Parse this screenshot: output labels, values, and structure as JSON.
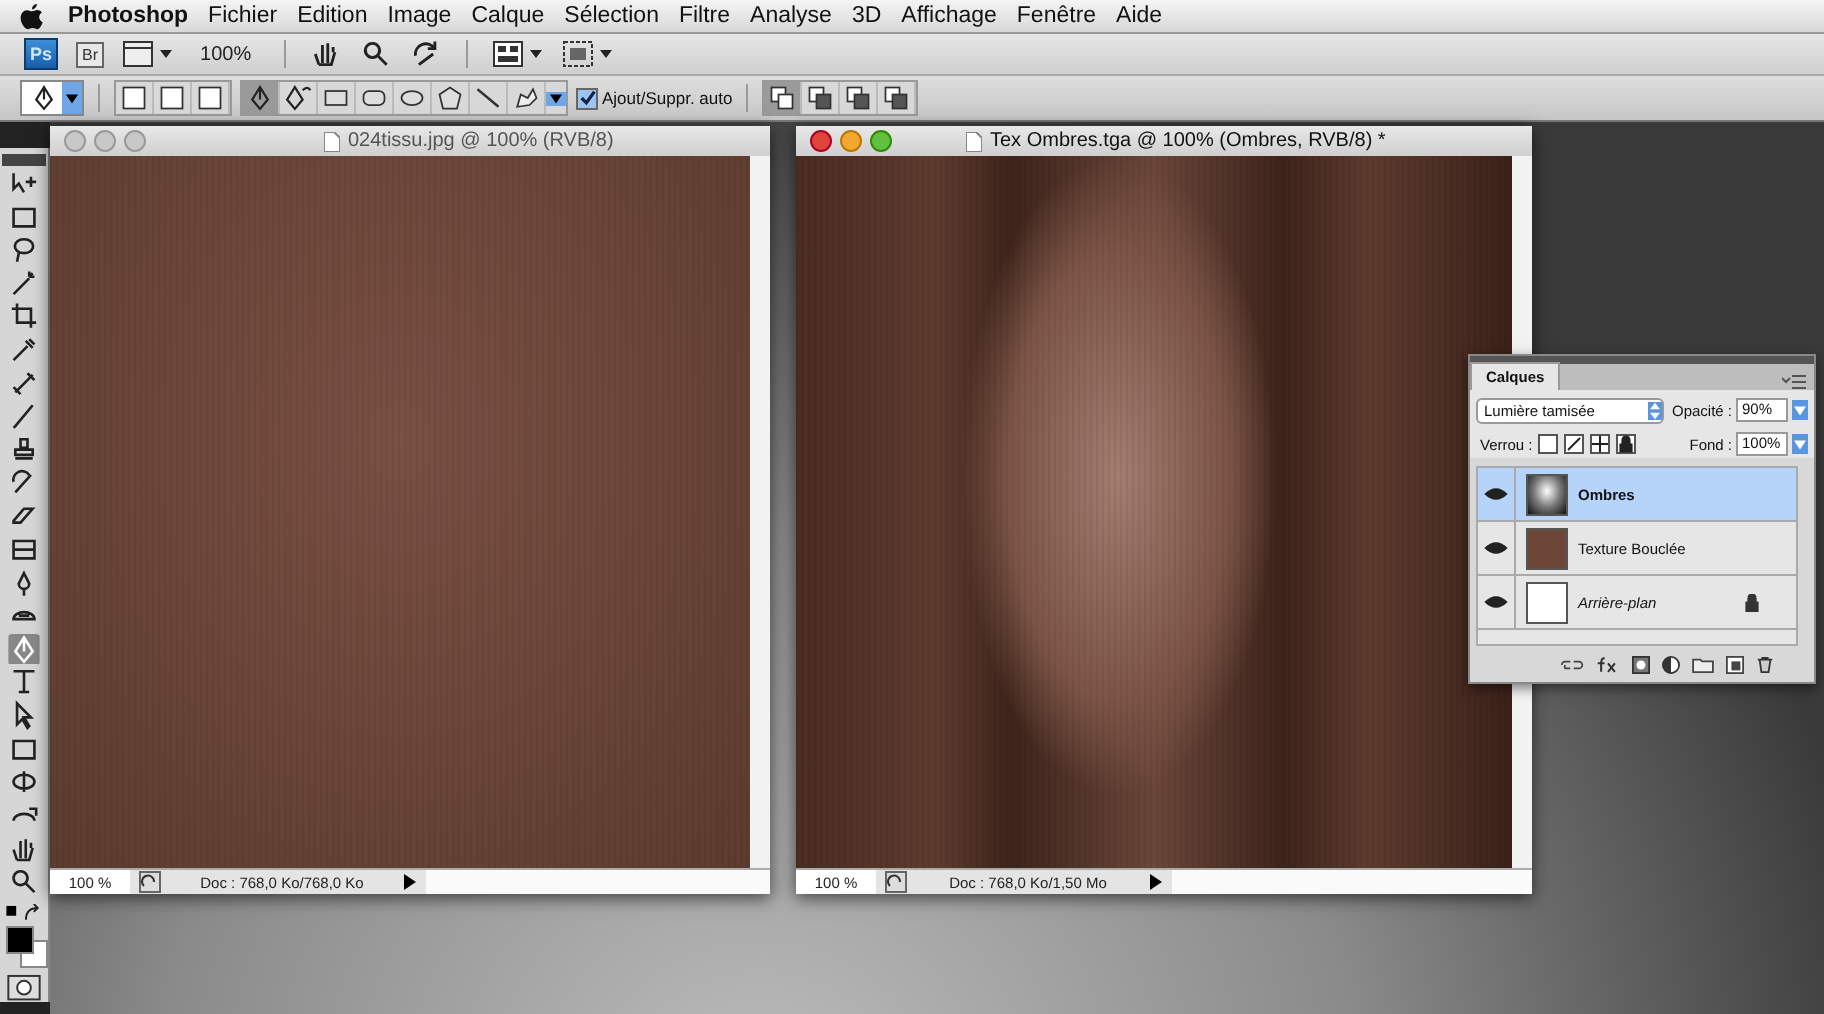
{
  "menu_bar": {
    "app_name": "Photoshop",
    "items": [
      "Fichier",
      "Edition",
      "Image",
      "Calque",
      "Sélection",
      "Filtre",
      "Analyse",
      "3D",
      "Affichage",
      "Fenêtre",
      "Aide"
    ]
  },
  "app_bar": {
    "logo": "Ps",
    "bridge": "Br",
    "zoom": "100%"
  },
  "options_bar": {
    "auto_add_delete": {
      "label": "Ajout/Suppr. auto",
      "checked": true
    }
  },
  "tools": [
    {
      "selected": false
    },
    {
      "selected": false
    },
    {
      "selected": false
    },
    {
      "selected": false
    },
    {
      "selected": false
    },
    {
      "selected": false
    },
    {
      "selected": false
    },
    {
      "selected": false
    },
    {
      "selected": false
    },
    {
      "selected": false
    },
    {
      "selected": false
    },
    {
      "selected": false
    },
    {
      "selected": false
    },
    {
      "selected": false
    },
    {
      "selected": true
    },
    {
      "selected": false
    },
    {
      "selected": false
    },
    {
      "selected": false
    },
    {
      "selected": false
    },
    {
      "selected": false
    },
    {
      "selected": false
    },
    {
      "selected": false
    }
  ],
  "documents": [
    {
      "title": "024tissu.jpg @ 100% (RVB/8)",
      "active": false,
      "kind": "plain",
      "zoom": "100 %",
      "doc_size": "Doc : 768,0 Ko/768,0 Ko"
    },
    {
      "title": "Tex Ombres.tga @ 100% (Ombres, RVB/8) *",
      "active": true,
      "kind": "shaded",
      "zoom": "100 %",
      "doc_size": "Doc : 768,0 Ko/1,50 Mo"
    }
  ],
  "layers_panel": {
    "tab": "Calques",
    "blend_mode": "Lumière tamisée",
    "opacity_label": "Opacité :",
    "opacity": "90%",
    "lock_label": "Verrou :",
    "fill_label": "Fond :",
    "fill": "100%",
    "layers": [
      {
        "name": "Ombres",
        "kind": "shadow",
        "selected": true,
        "visible": true,
        "locked": false
      },
      {
        "name": "Texture Bouclée",
        "kind": "texture",
        "selected": false,
        "visible": true,
        "locked": false
      },
      {
        "name": "Arrière-plan",
        "kind": "background",
        "selected": false,
        "visible": true,
        "locked": true
      }
    ]
  }
}
